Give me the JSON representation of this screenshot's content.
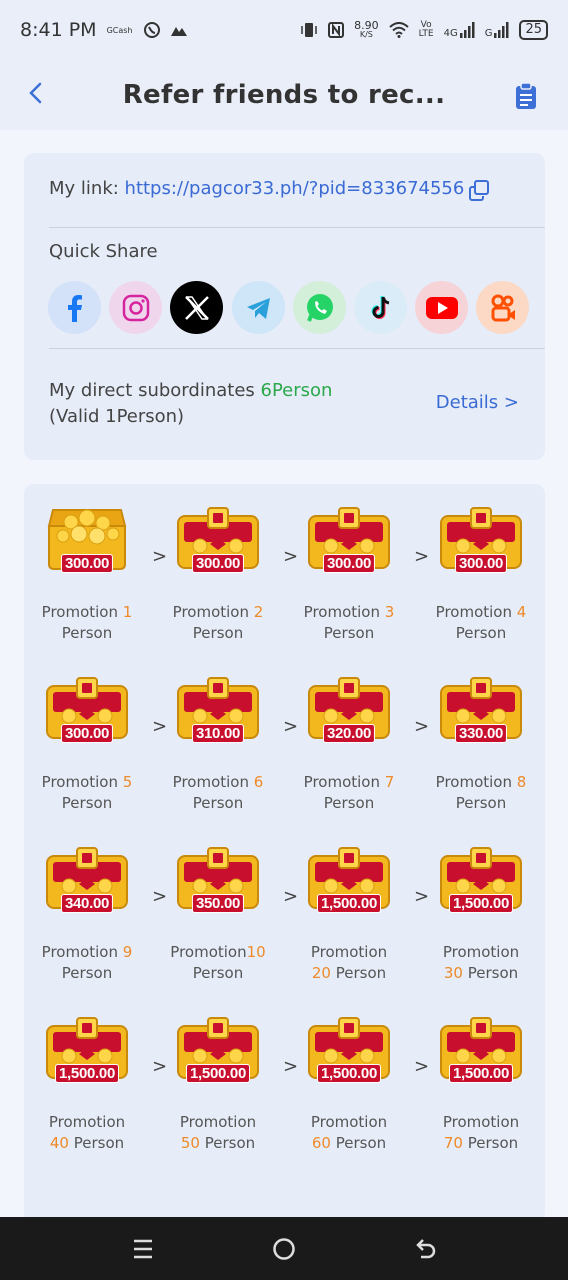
{
  "status_bar": {
    "time": "8:41 PM",
    "gcash_label": "GCash",
    "speed_value": "8.90",
    "speed_unit": "K/S",
    "volte_top": "Vo",
    "volte_bottom": "LTE",
    "network_4g": "4G",
    "network_g": "G",
    "battery": "25"
  },
  "header": {
    "title": "Refer friends to rec..."
  },
  "link_card": {
    "link_label": "My link: ",
    "link_url": "https://pagcor33.ph/?pid=833674556",
    "quick_share_title": "Quick Share",
    "share_targets": [
      "facebook",
      "instagram",
      "x",
      "telegram",
      "whatsapp",
      "tiktok",
      "youtube",
      "kuaishou"
    ],
    "subordinates_prefix": "My direct subordinates ",
    "subordinates_count": "6Person",
    "subordinates_suffix": " (Valid 1Person)",
    "details_label": "Details >"
  },
  "rewards": {
    "prefix": "Promotion",
    "suffix": "Person",
    "arrow": ">",
    "items": [
      {
        "amount": "300.00",
        "num": "1",
        "opened": true
      },
      {
        "amount": "300.00",
        "num": "2"
      },
      {
        "amount": "300.00",
        "num": "3"
      },
      {
        "amount": "300.00",
        "num": "4"
      },
      {
        "amount": "300.00",
        "num": "5"
      },
      {
        "amount": "310.00",
        "num": "6"
      },
      {
        "amount": "320.00",
        "num": "7"
      },
      {
        "amount": "330.00",
        "num": "8"
      },
      {
        "amount": "340.00",
        "num": "9"
      },
      {
        "amount": "350.00",
        "num": "10"
      },
      {
        "amount": "1,500.00",
        "num": "20"
      },
      {
        "amount": "1,500.00",
        "num": "30"
      },
      {
        "amount": "1,500.00",
        "num": "40"
      },
      {
        "amount": "1,500.00",
        "num": "50"
      },
      {
        "amount": "1,500.00",
        "num": "60"
      },
      {
        "amount": "1,500.00",
        "num": "70"
      }
    ]
  },
  "colors": {
    "accent_blue": "#3a6bd5",
    "count_green": "#2aa84a",
    "number_orange": "#ee8a2a",
    "chest_red": "#c8102e",
    "chest_gold": "#f4b81f"
  }
}
